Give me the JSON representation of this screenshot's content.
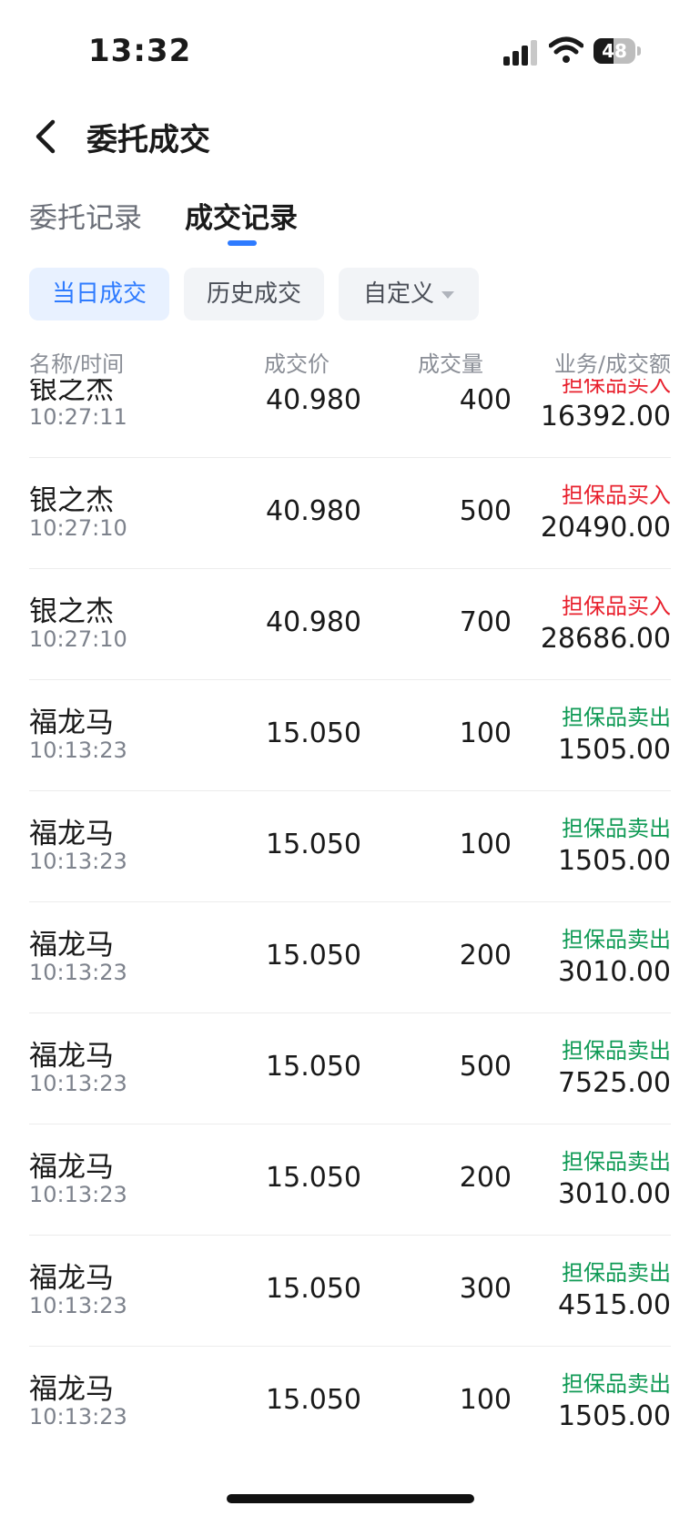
{
  "status": {
    "time": "13:32",
    "battery": "48",
    "battery_level_percent": 48,
    "signal_icon": "cellular-signal-icon",
    "wifi_icon": "wifi-icon"
  },
  "nav": {
    "back_icon": "chevron-left-icon",
    "title": "委托成交"
  },
  "tabs": [
    {
      "label": "委托记录",
      "active": false
    },
    {
      "label": "成交记录",
      "active": true
    }
  ],
  "filters": [
    {
      "label": "当日成交",
      "active": true
    },
    {
      "label": "历史成交",
      "active": false
    },
    {
      "label": "自定义",
      "active": false,
      "dropdown": true
    }
  ],
  "columns": [
    "名称/时间",
    "成交价",
    "成交量",
    "业务/成交额"
  ],
  "rows": [
    {
      "name": "银之杰",
      "time": "10:27:11",
      "price": "40.980",
      "qty": "400",
      "biz": "担保品买入",
      "side": "buy",
      "amount": "16392.00"
    },
    {
      "name": "银之杰",
      "time": "10:27:10",
      "price": "40.980",
      "qty": "500",
      "biz": "担保品买入",
      "side": "buy",
      "amount": "20490.00"
    },
    {
      "name": "银之杰",
      "time": "10:27:10",
      "price": "40.980",
      "qty": "700",
      "biz": "担保品买入",
      "side": "buy",
      "amount": "28686.00"
    },
    {
      "name": "福龙马",
      "time": "10:13:23",
      "price": "15.050",
      "qty": "100",
      "biz": "担保品卖出",
      "side": "sell",
      "amount": "1505.00"
    },
    {
      "name": "福龙马",
      "time": "10:13:23",
      "price": "15.050",
      "qty": "100",
      "biz": "担保品卖出",
      "side": "sell",
      "amount": "1505.00"
    },
    {
      "name": "福龙马",
      "time": "10:13:23",
      "price": "15.050",
      "qty": "200",
      "biz": "担保品卖出",
      "side": "sell",
      "amount": "3010.00"
    },
    {
      "name": "福龙马",
      "time": "10:13:23",
      "price": "15.050",
      "qty": "500",
      "biz": "担保品卖出",
      "side": "sell",
      "amount": "7525.00"
    },
    {
      "name": "福龙马",
      "time": "10:13:23",
      "price": "15.050",
      "qty": "200",
      "biz": "担保品卖出",
      "side": "sell",
      "amount": "3010.00"
    },
    {
      "name": "福龙马",
      "time": "10:13:23",
      "price": "15.050",
      "qty": "300",
      "biz": "担保品卖出",
      "side": "sell",
      "amount": "4515.00"
    },
    {
      "name": "福龙马",
      "time": "10:13:23",
      "price": "15.050",
      "qty": "100",
      "biz": "担保品卖出",
      "side": "sell",
      "amount": "1505.00"
    }
  ],
  "colors": {
    "accent": "#2e7bff",
    "buy": "#e8202d",
    "sell": "#0f9a55"
  }
}
